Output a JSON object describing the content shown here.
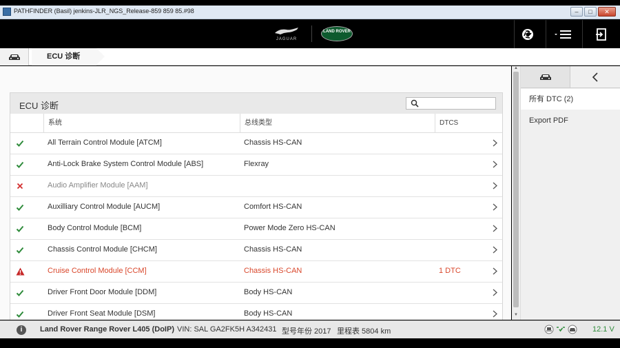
{
  "window": {
    "title": "PATHFINDER (Basil) jenkins-JLR_NGS_Release-859 859 85.#98"
  },
  "header": {
    "jaguar_logo_text": "JAGUAR",
    "land_rover_logo_text": "LAND ROVER"
  },
  "breadcrumb": {
    "current": "ECU 诊断"
  },
  "panel": {
    "title": "ECU 诊断",
    "search_placeholder": "",
    "columns": {
      "system": "系统",
      "bus_type": "总线类型",
      "dtcs": "DTCS"
    }
  },
  "rows": [
    {
      "status": "ok",
      "name": "All Terrain Control Module [ATCM]",
      "bus": "Chassis HS-CAN",
      "dtc": ""
    },
    {
      "status": "ok",
      "name": "Anti-Lock Brake System Control Module [ABS]",
      "bus": "Flexray",
      "dtc": ""
    },
    {
      "status": "fail",
      "name": "Audio Amplifier Module [AAM]",
      "bus": "",
      "dtc": ""
    },
    {
      "status": "ok",
      "name": "Auxilliary Control Module [AUCM]",
      "bus": "Comfort HS-CAN",
      "dtc": ""
    },
    {
      "status": "ok",
      "name": "Body Control Module [BCM]",
      "bus": "Power Mode Zero HS-CAN",
      "dtc": ""
    },
    {
      "status": "ok",
      "name": "Chassis Control Module [CHCM]",
      "bus": "Chassis HS-CAN",
      "dtc": ""
    },
    {
      "status": "warn",
      "name": "Cruise Control Module [CCM]",
      "bus": "Chassis HS-CAN",
      "dtc": "1 DTC"
    },
    {
      "status": "ok",
      "name": "Driver Front Door Module [DDM]",
      "bus": "Body HS-CAN",
      "dtc": ""
    },
    {
      "status": "ok",
      "name": "Driver Front Seat Module [DSM]",
      "bus": "Body HS-CAN",
      "dtc": ""
    }
  ],
  "side": {
    "items": [
      {
        "label": "所有 DTC (2)"
      },
      {
        "label": "Export PDF"
      }
    ]
  },
  "status": {
    "vehicle": "Land Rover Range Rover L405 (DoIP)",
    "vin": "VIN: SAL GA2FK5H A342431",
    "model_year": "型号年份 2017",
    "odometer": "里程表 5804 km",
    "voltage": "12.1 V"
  },
  "colors": {
    "ok": "#2e8b3a",
    "fail": "#d32f2f",
    "warn": "#c62828",
    "alert_text": "#d9472b",
    "voltage": "#2e8b3a"
  },
  "icons": {
    "ok": "check-icon",
    "fail": "cross-icon",
    "warn": "warning-icon"
  }
}
